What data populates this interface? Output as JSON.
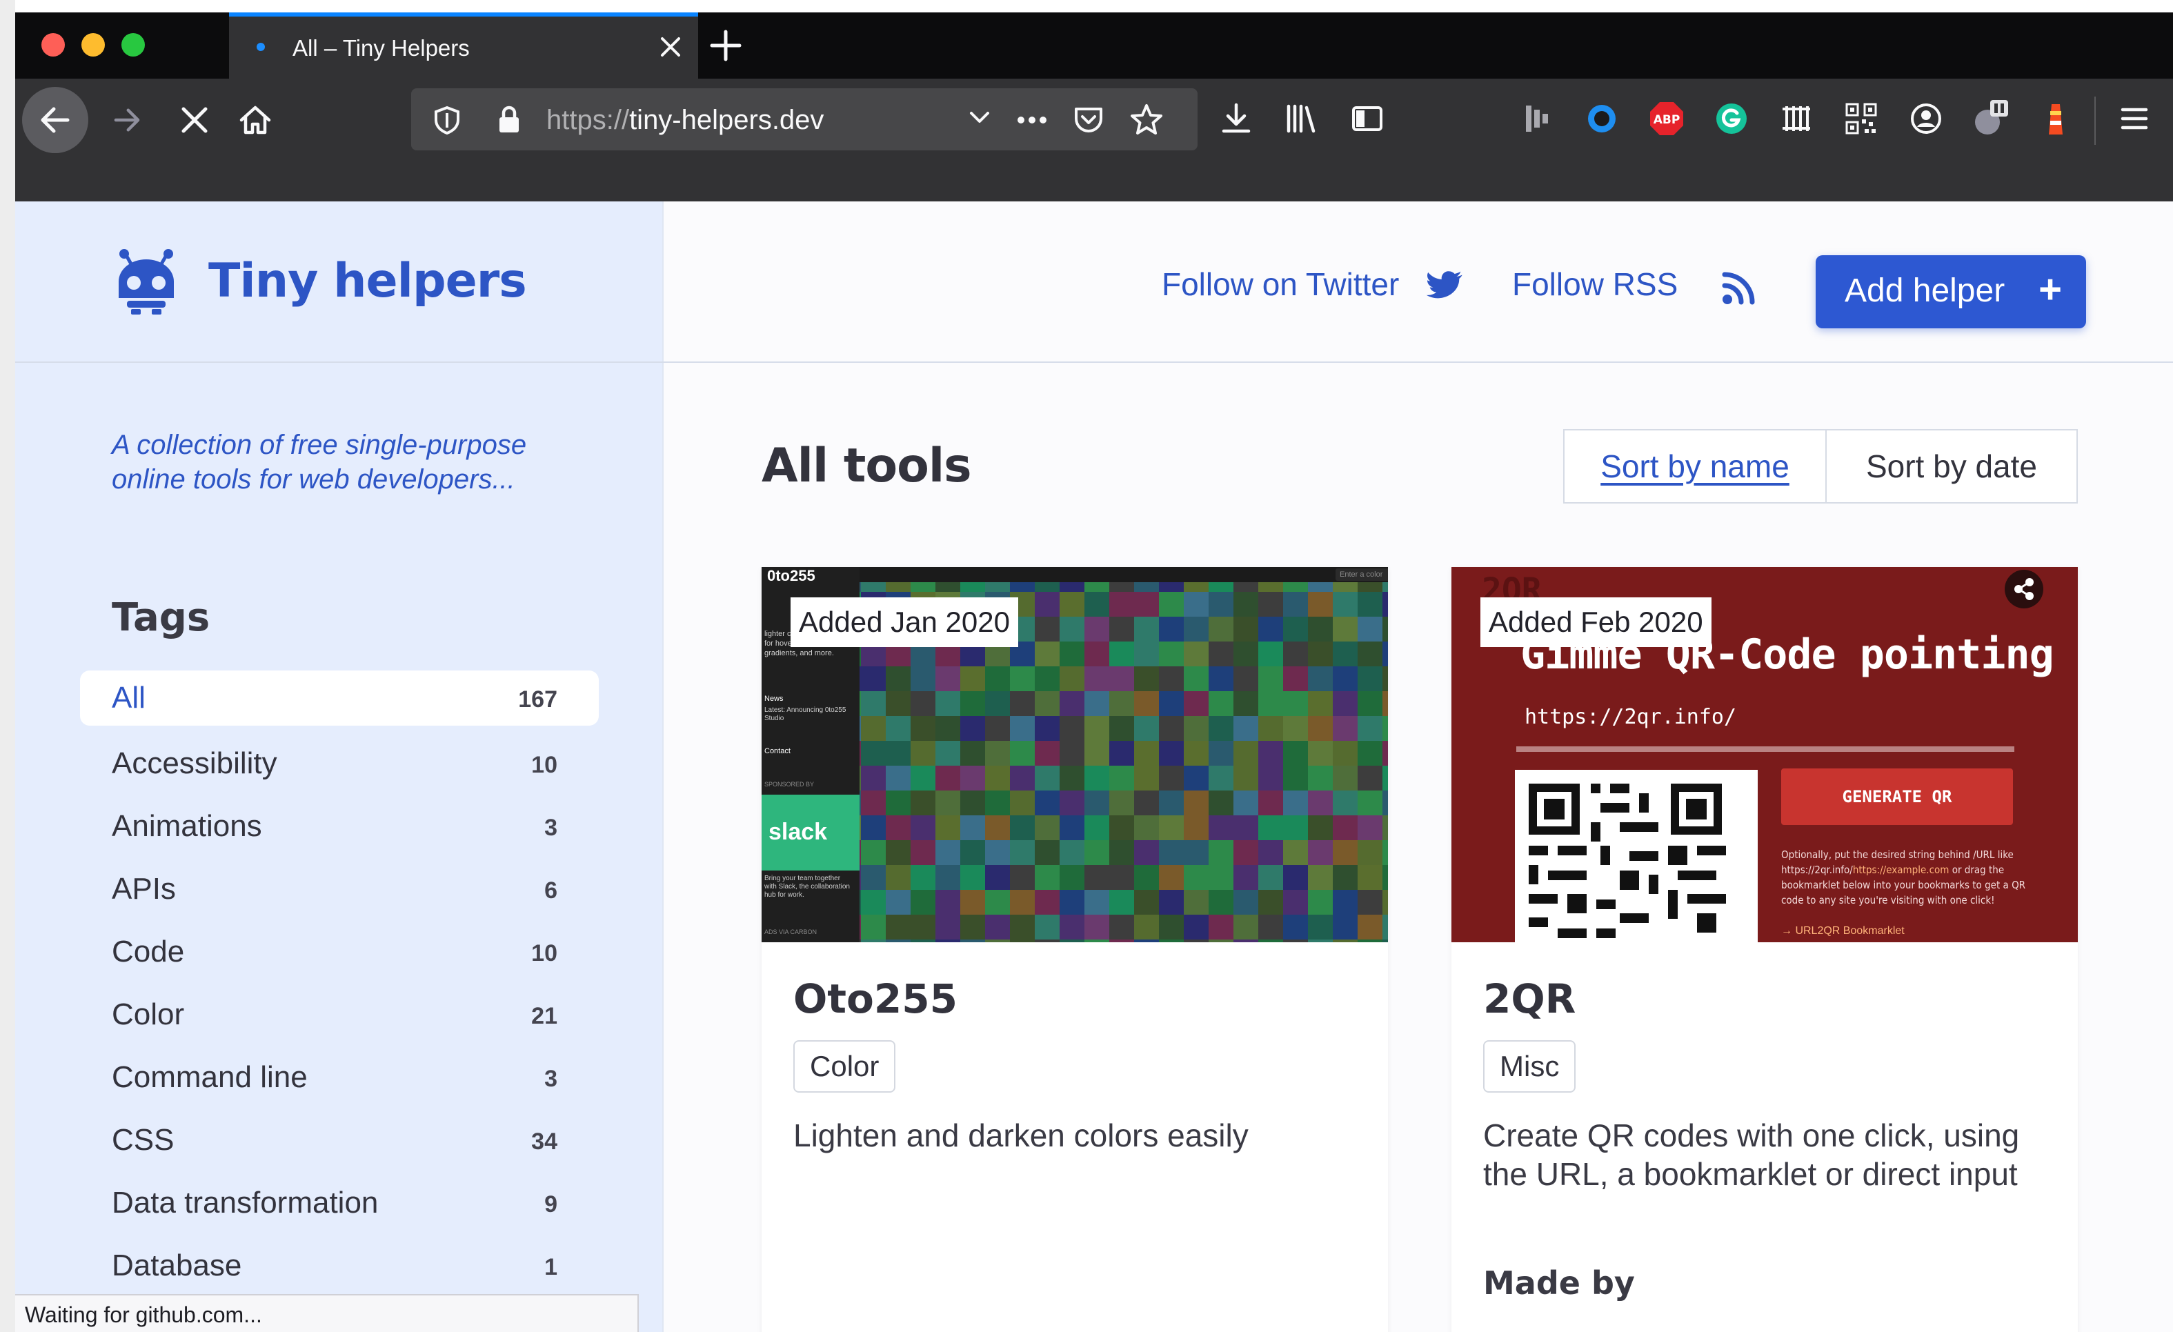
{
  "browser": {
    "tab_title": "All – Tiny Helpers",
    "url_scheme": "https://",
    "url_host": "tiny-helpers.dev",
    "status_text": "Waiting for github.com..."
  },
  "header": {
    "brand_name": "Tiny helpers",
    "follow_twitter": "Follow on Twitter",
    "follow_rss": "Follow RSS",
    "add_helper": "Add helper",
    "add_helper_plus": "+"
  },
  "sidebar": {
    "tagline": "A collection of free single-purpose online tools for web developers...",
    "tags_heading": "Tags",
    "tags": [
      {
        "label": "All",
        "count": "167"
      },
      {
        "label": "Accessibility",
        "count": "10"
      },
      {
        "label": "Animations",
        "count": "3"
      },
      {
        "label": "APIs",
        "count": "6"
      },
      {
        "label": "Code",
        "count": "10"
      },
      {
        "label": "Color",
        "count": "21"
      },
      {
        "label": "Command line",
        "count": "3"
      },
      {
        "label": "CSS",
        "count": "34"
      },
      {
        "label": "Data transformation",
        "count": "9"
      },
      {
        "label": "Database",
        "count": "1"
      }
    ]
  },
  "main": {
    "title": "All tools",
    "sort_by_name": "Sort by name",
    "sort_by_date": "Sort by date",
    "cards": [
      {
        "added": "Added Jan 2020",
        "title": "Oto255",
        "tag": "Color",
        "description": "Lighten and darken colors easily",
        "shot": {
          "logo": "0to255",
          "text_1": "lighter colors. It's perfect for hover states, borders, gradients, and more.",
          "news": "News",
          "news_detail": "Latest: Announcing 0to255 Studio",
          "contact": "Contact",
          "sponsored": "SPONSORED BY",
          "slack": "slack",
          "slack_text": "Bring your team together with Slack, the collaboration hub for work.",
          "ads": "ADS VIA CARBON",
          "input_placeholder": "Enter a color"
        }
      },
      {
        "added": "Added Feb 2020",
        "title": "2QR",
        "tag": "Misc",
        "description": "Create QR codes with one click, using the URL, a bookmarklet or direct input",
        "made_by": "Made by",
        "shot": {
          "logo": "2QR",
          "headline": "Gimme QR-Code pointing to",
          "url": "https://2qr.info/",
          "generate": "GENERATE QR",
          "note_1": "Optionally, put the desired string behind /URL like https://2qr.info/",
          "note_link": "https://example.com",
          "note_2": " or drag the bookmarklet below into your bookmarks to get a QR code to any site you're visiting with one click!",
          "bookmarklet": "→ URL2QR Bookmarklet"
        }
      }
    ]
  },
  "colors": {
    "brand_blue": "#2d55c5",
    "button_blue": "#2d58d2",
    "sidebar_bg": "#e5edfd",
    "qr_red": "#7a1b1b",
    "slack_green": "#2eb67d"
  },
  "icons": [
    "back-arrow-icon",
    "forward-arrow-icon",
    "stop-icon",
    "home-icon",
    "shield-icon",
    "lock-icon",
    "chevron-down-icon",
    "more-icon",
    "pocket-icon",
    "star-icon",
    "download-icon",
    "library-icon",
    "sidebar-icon",
    "twitter-icon",
    "rss-icon",
    "plus-icon",
    "robot-logo-icon",
    "share-icon"
  ]
}
